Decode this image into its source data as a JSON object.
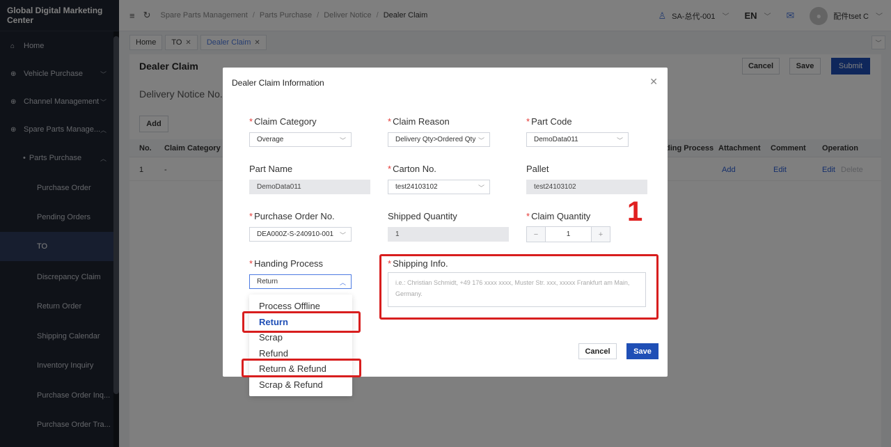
{
  "sidebar": {
    "brand": "Global Digital Marketing Center",
    "items": [
      {
        "label": "Home",
        "icon": "home-icon"
      },
      {
        "label": "Vehicle Purchase",
        "icon": "plus-circle-icon"
      },
      {
        "label": "Channel Management",
        "icon": "plus-circle-icon"
      },
      {
        "label": "Spare Parts Manage...",
        "icon": "plus-circle-icon"
      },
      {
        "label": "Parts Purchase"
      },
      {
        "label": "Purchase Order"
      },
      {
        "label": "Pending Orders"
      },
      {
        "label": "TO"
      },
      {
        "label": "Discrepancy Claim"
      },
      {
        "label": "Return Order"
      },
      {
        "label": "Shipping Calendar"
      },
      {
        "label": "Inventory Inquiry"
      },
      {
        "label": "Purchase Order Inq..."
      },
      {
        "label": "Purchase Order Tra..."
      }
    ]
  },
  "topbar": {
    "breadcrumbs": [
      "Spare Parts Management",
      "Parts Purchase",
      "Deliver Notice",
      "Dealer Claim"
    ],
    "account": "SA-总代-001",
    "language": "EN",
    "user_name": "配件tset C"
  },
  "tabs": [
    {
      "label": "Home"
    },
    {
      "label": "TO"
    },
    {
      "label": "Dealer Claim"
    }
  ],
  "page": {
    "title": "Dealer Claim",
    "cancel_label": "Cancel",
    "save_label": "Save",
    "submit_label": "Submit",
    "delivery_notice": "Delivery Notice No.: T",
    "add_label": "Add",
    "columns": {
      "no": "No.",
      "claim_category": "Claim Category",
      "handling_process": "ding Process",
      "attachment": "Attachment",
      "comment": "Comment",
      "operation": "Operation"
    },
    "row": {
      "no": "1",
      "claim_category": "-",
      "attachment": "Add",
      "comment": "Edit",
      "op_edit": "Edit",
      "op_delete": "Delete"
    }
  },
  "modal": {
    "title": "Dealer Claim Information",
    "fields": {
      "claim_category": {
        "label": "Claim Category",
        "value": "Overage"
      },
      "claim_reason": {
        "label": "Claim Reason",
        "value": "Delivery Qty>Ordered Qty"
      },
      "part_code": {
        "label": "Part Code",
        "value": "DemoData011"
      },
      "part_name": {
        "label": "Part Name",
        "value": "DemoData011"
      },
      "carton_no": {
        "label": "Carton No.",
        "value": "test24103102"
      },
      "pallet": {
        "label": "Pallet",
        "value": "test24103102"
      },
      "purchase_order_no": {
        "label": "Purchase Order No.",
        "value": "DEA000Z-S-240910-001"
      },
      "shipped_quantity": {
        "label": "Shipped Quantity",
        "value": "1"
      },
      "claim_quantity": {
        "label": "Claim Quantity",
        "value": "1"
      },
      "handing_process": {
        "label": "Handing Process",
        "value": "Return"
      },
      "shipping_info": {
        "label": "Shipping Info.",
        "placeholder": "i.e.: Christian Schmidt, +49 176 xxxx xxxx, Muster Str. xxx, xxxxx Frankfurt am Main, Germany."
      }
    },
    "cancel_label": "Cancel",
    "save_label": "Save",
    "annotation": "1"
  },
  "dropdown": {
    "options": [
      "Process Offline",
      "Return",
      "Scrap",
      "Refund",
      "Return & Refund",
      "Scrap & Refund"
    ],
    "selected": "Return"
  },
  "colors": {
    "primary": "#1f4fb6",
    "highlight": "#d81e1e",
    "sidebar_bg": "#1f2430",
    "active_nav": "#2f3d5e"
  }
}
